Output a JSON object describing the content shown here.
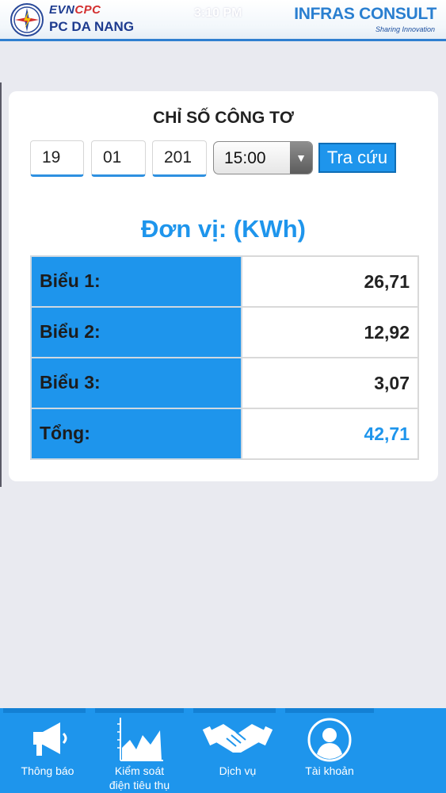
{
  "header": {
    "brand_evn": "EVN",
    "brand_cpc": "CPC",
    "brand_name": "PC DA NANG",
    "status_time": "3:10 PM",
    "partner": "INFRAS CONSULT",
    "partner_tagline": "Sharing Innovation"
  },
  "card": {
    "title": "CHỈ SỐ CÔNG TƠ",
    "day": "19",
    "month": "01",
    "year": "201",
    "time_selected": "15:00",
    "search_label": "Tra cứu",
    "unit_label": "Đơn vị: (KWh)",
    "rows": [
      {
        "label": "Biểu 1:",
        "value": "26,71"
      },
      {
        "label": "Biểu 2:",
        "value": "12,92"
      },
      {
        "label": "Biểu 3:",
        "value": "3,07"
      },
      {
        "label": "Tổng:",
        "value": "42,71"
      }
    ]
  },
  "nav": {
    "items": [
      {
        "label": "Thông báo",
        "icon": "megaphone-icon"
      },
      {
        "label": "Kiểm soát",
        "label2": "điện tiêu thụ",
        "icon": "chart-icon"
      },
      {
        "label": "Dịch vụ",
        "icon": "handshake-icon"
      },
      {
        "label": "Tài khoản",
        "icon": "user-icon"
      }
    ]
  },
  "colors": {
    "accent": "#1e95ec",
    "brand_blue": "#1d3b8f",
    "brand_red": "#d32f2f"
  }
}
